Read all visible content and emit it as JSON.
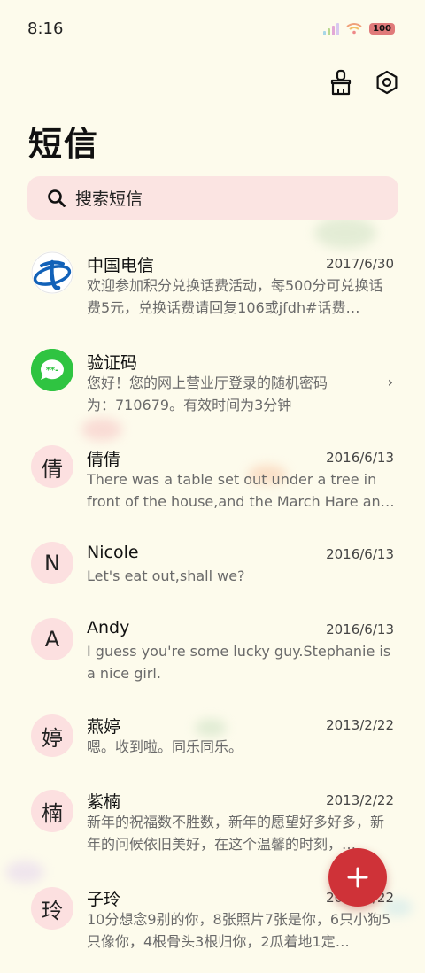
{
  "status_bar": {
    "time": "8:16",
    "battery": "100"
  },
  "header": {
    "title": "短信"
  },
  "search": {
    "placeholder": "搜索短信"
  },
  "conversations": [
    {
      "avatar": "",
      "avatar_type": "china-telecom-logo",
      "name": "中国电信",
      "date": "2017/6/30",
      "preview": "欢迎参加积分兑换话费活动，每500分可兑换话费5元，兑换话费请回复106或jfdh#话费…"
    },
    {
      "avatar": "",
      "avatar_type": "message-bubble-icon",
      "name": "验证码",
      "date": "",
      "preview": "您好！您的网上营业厅登录的随机密码为：710679。有效时间为3分钟"
    },
    {
      "avatar": "倩",
      "name": "倩倩",
      "date": "2016/6/13",
      "preview": "There was a table set out under a tree in front of the house,and the March Hare an…"
    },
    {
      "avatar": "N",
      "name": "Nicole",
      "date": "2016/6/13",
      "preview": "Let's eat out,shall we?"
    },
    {
      "avatar": "A",
      "name": "Andy",
      "date": "2016/6/13",
      "preview": "I guess you're some lucky guy.Stephanie is a nice girl."
    },
    {
      "avatar": "婷",
      "name": "燕婷",
      "date": "2013/2/22",
      "preview": "嗯。收到啦。同乐同乐。"
    },
    {
      "avatar": "楠",
      "name": "紫楠",
      "date": "2013/2/22",
      "preview": "新年的祝福数不胜数，新年的愿望好多好多，新年的问候依旧美好，在这个温馨的时刻，…"
    },
    {
      "avatar": "玲",
      "name": "子玲",
      "date": "2013/2/22",
      "preview": "10分想念9别的你，8张照片7张是你，6只小狗5只像你，4根骨头3根归你，2瓜着地1定…"
    }
  ]
}
